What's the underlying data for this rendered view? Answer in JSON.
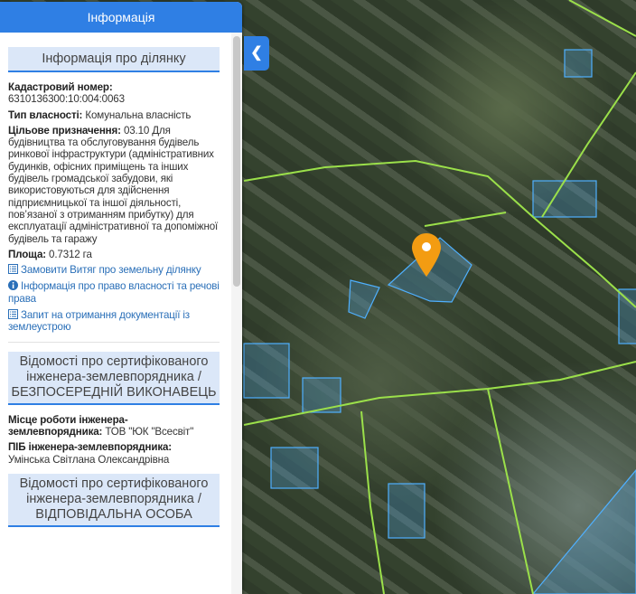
{
  "panel": {
    "title": "Інформація"
  },
  "parcel": {
    "section_title": "Інформація про ділянку",
    "cadastral_label": "Кадастровий номер:",
    "cadastral_value": "6310136300:10:004:0063",
    "ownership_label": "Тип власності:",
    "ownership_value": "Комунальна власність",
    "purpose_label": "Цільове призначення:",
    "purpose_value": "03.10 Для будівництва та обслуговування будівель ринкової інфраструктури (адміністративних будинків, офісних приміщень та інших будівель громадської забудови, які використовуються для здійснення підприємницької та іншої діяльності, пов’язаної з отриманням прибутку) для експлуатації адміністративної та допоміжної будівель та гаражу",
    "area_label": "Площа:",
    "area_value": "0.7312 га",
    "links": [
      {
        "label": "Замовити Витяг про земельну ділянку",
        "icon": "list-icon"
      },
      {
        "label": "Інформація про право власності та речові права",
        "icon": "info-circle-icon"
      },
      {
        "label": "Запит на отримання документації із землеустрою",
        "icon": "list-icon"
      }
    ]
  },
  "engineer": {
    "section_title": "Відомості про сертифікованого інженера-землевпорядника / БЕЗПОСЕРЕДНІЙ ВИКОНАВЕЦЬ",
    "workplace_label": "Місце роботи інженера-землевпорядника:",
    "workplace_value": "ТОВ \"ЮК \"Всесвіт\"",
    "name_label": "ПІБ інженера-землевпорядника:",
    "name_value": "Умінська Світлана Олександрівна"
  },
  "responsible": {
    "section_title": "Відомості про сертифікованого інженера-землевпорядника / ВІДПОВІДАЛЬНА ОСОБА"
  },
  "map": {
    "toggle_icon": "chevron-left-icon",
    "marker_color": "#f39c12",
    "parcel_color": "#4fb0ff",
    "road_color": "#9be04a"
  }
}
